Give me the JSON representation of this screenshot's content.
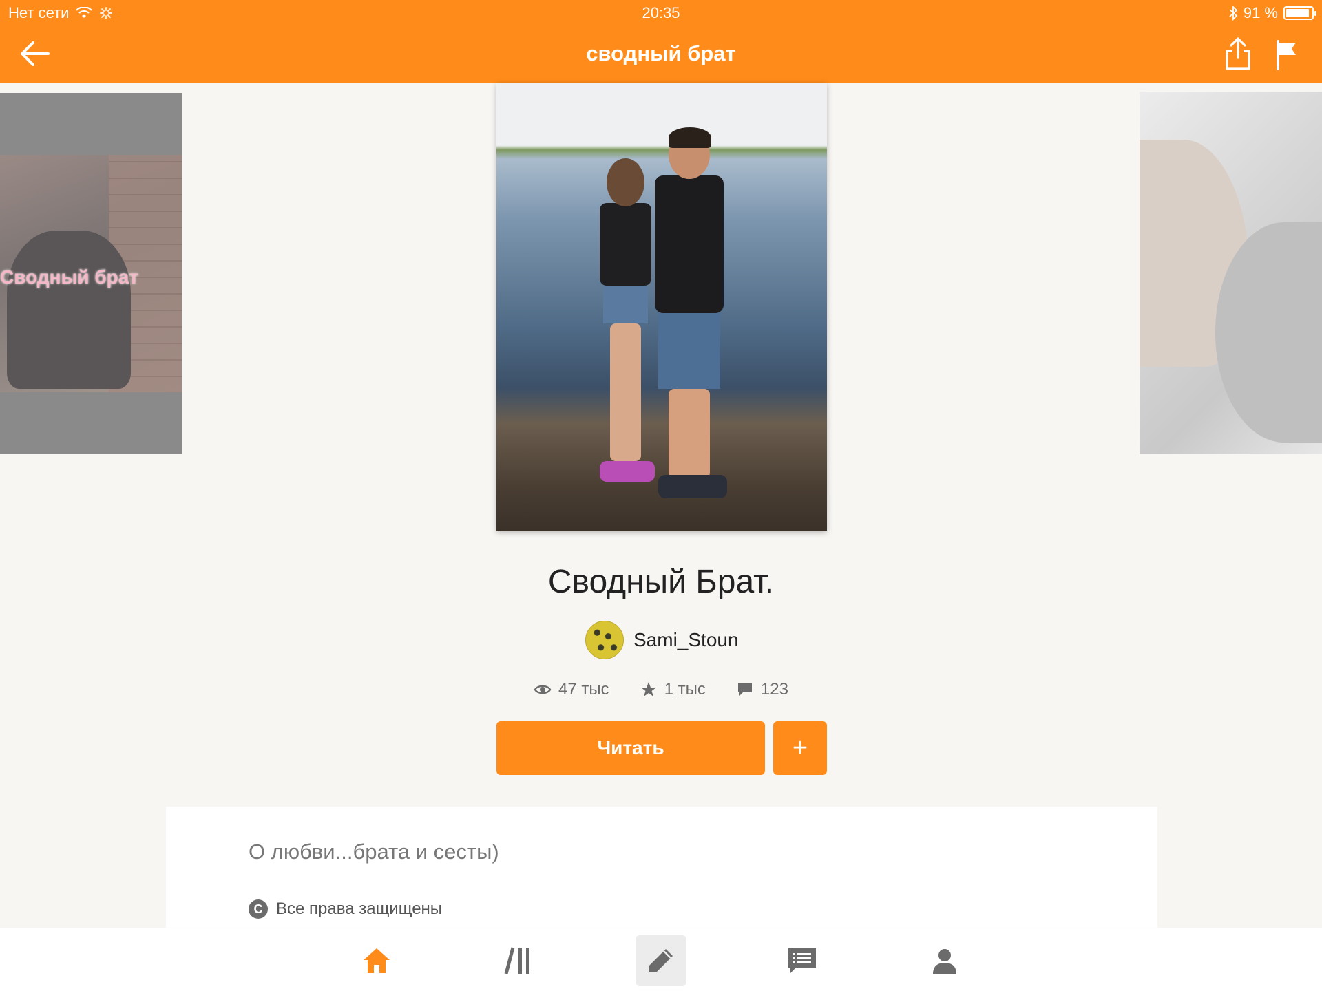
{
  "status_bar": {
    "carrier": "Нет сети",
    "time": "20:35",
    "battery": "91 %",
    "battery_level": 0.91
  },
  "nav": {
    "title": "сводный брат",
    "back_icon": "arrow-left-icon",
    "share_icon": "share-icon",
    "flag_icon": "flag-icon"
  },
  "carousel": {
    "left_cover_text": "Сводный брат"
  },
  "story": {
    "title": "Сводный Брат.",
    "author": "Sami_Stoun",
    "views": "47 тыс",
    "votes": "1 тыс",
    "comments": "123",
    "read_label": "Читать",
    "add_label": "+"
  },
  "description": {
    "text": "О любви...брата и сесты)",
    "copyright": "Все права защищены",
    "copyright_icon": "C"
  },
  "tabs": [
    {
      "name": "home",
      "icon": "home-icon"
    },
    {
      "name": "library",
      "icon": "library-icon"
    },
    {
      "name": "write",
      "icon": "pencil-icon"
    },
    {
      "name": "messages",
      "icon": "messages-icon"
    },
    {
      "name": "profile",
      "icon": "profile-icon"
    }
  ],
  "colors": {
    "accent": "#ff8c1a",
    "background": "#f8f6f3"
  }
}
